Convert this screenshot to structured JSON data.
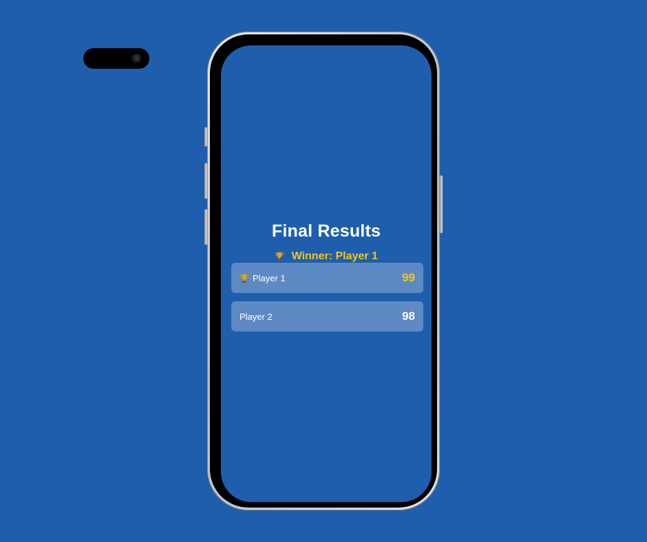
{
  "results": {
    "title": "Final Results",
    "winner_label": "Winner: Player 1",
    "players": [
      {
        "name": "Player 1",
        "score": "99",
        "is_winner": true
      },
      {
        "name": "Player 2",
        "score": "98",
        "is_winner": false
      }
    ]
  },
  "icons": {
    "trophy": "trophy-icon",
    "camera": "camera-icon"
  },
  "colors": {
    "background": "#1f5ead",
    "accent": "#f5c518",
    "text": "#ffffff"
  }
}
